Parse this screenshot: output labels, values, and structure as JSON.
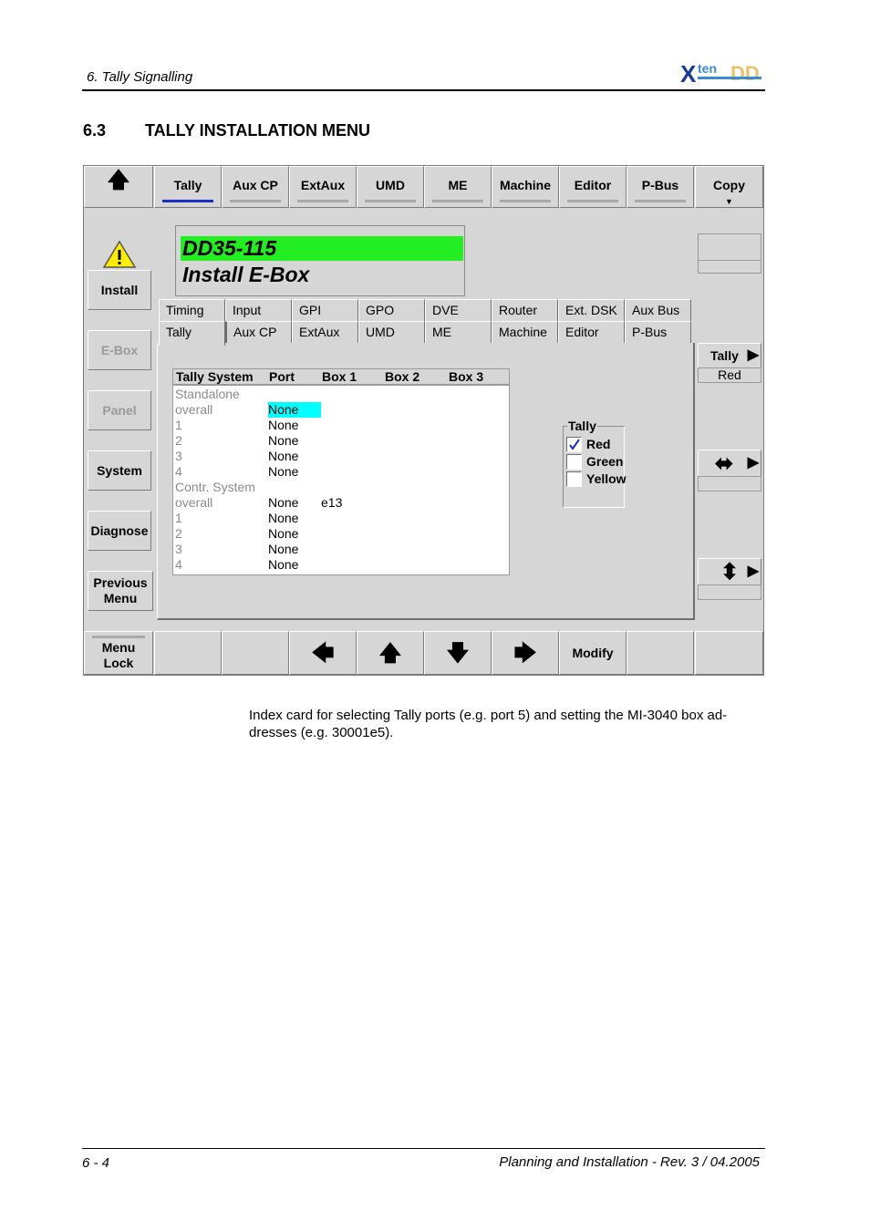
{
  "page": {
    "header_text": "6. Tally Signalling",
    "logo_text": "XtenDD",
    "section_number": "6.3",
    "section_title": "TALLY INSTALLATION MENU",
    "caption": "Index card for selecting Tally ports (e.g. port 5) and setting the MI-3040 box ad-dresses (e.g. 30001e5).",
    "page_number": "6 - 4",
    "footer": "Planning and Installation  -  Rev. 3 / 04.2005"
  },
  "top_bar": {
    "up_arrow": "🡅",
    "buttons": [
      "Tally",
      "Aux CP",
      "ExtAux",
      "UMD",
      "ME",
      "Machine",
      "Editor",
      "P-Bus",
      "Copy"
    ],
    "active": "Tally",
    "copy_indicator": "▼"
  },
  "title_box": {
    "device_id": "DD35-115",
    "menu_title": "Install E-Box"
  },
  "side_menu": {
    "install": "Install",
    "ebox": "E-Box",
    "panel": "Panel",
    "system": "System",
    "diagnose": "Diagnose",
    "previous": "Previous Menu"
  },
  "tabs_row1": [
    "Timing",
    "Input",
    "GPI",
    "GPO",
    "DVE",
    "Router",
    "Ext. DSK",
    "Aux Bus"
  ],
  "tabs_row2": [
    "Tally",
    "Aux CP",
    "ExtAux",
    "UMD",
    "ME",
    "Machine",
    "Editor",
    "P-Bus"
  ],
  "table": {
    "headers": [
      "Tally System",
      "Port",
      "Box 1",
      "Box 2",
      "Box 3"
    ],
    "rows": [
      {
        "label": "Standalone",
        "port": "",
        "box1": ""
      },
      {
        "label": "overall",
        "port": "None",
        "box1": ""
      },
      {
        "label": "1",
        "port": "None",
        "box1": ""
      },
      {
        "label": "2",
        "port": "None",
        "box1": ""
      },
      {
        "label": "3",
        "port": "None",
        "box1": ""
      },
      {
        "label": "4",
        "port": "None",
        "box1": ""
      },
      {
        "label": "Contr. System",
        "port": "",
        "box1": ""
      },
      {
        "label": "overall",
        "port": "None",
        "box1": "e13"
      },
      {
        "label": "1",
        "port": "None",
        "box1": ""
      },
      {
        "label": "2",
        "port": "None",
        "box1": ""
      },
      {
        "label": "3",
        "port": "None",
        "box1": ""
      },
      {
        "label": "4",
        "port": "None",
        "box1": ""
      }
    ]
  },
  "tally_group": {
    "label": "Tally",
    "options": [
      {
        "label": "Red",
        "checked": true
      },
      {
        "label": "Green",
        "checked": false
      },
      {
        "label": "Yellow",
        "checked": false
      }
    ]
  },
  "right_panel": {
    "tally_button": "Tally",
    "tally_value": "Red",
    "play_icon": "▶",
    "horizontal_icon": "⬌",
    "vertical_icon": "⬍"
  },
  "bottom_bar": {
    "menu_lock": "Menu Lock",
    "left_arrow": "🡄",
    "up_arrow": "🡅",
    "down_arrow": "🡇",
    "right_arrow": "🡆",
    "modify": "Modify"
  },
  "colors": {
    "panel_gray": "#d6d6d6",
    "device_id_bg": "#22ee22",
    "selection_cyan": "#00ffff",
    "active_tab_bar": "#1a2ec8"
  }
}
